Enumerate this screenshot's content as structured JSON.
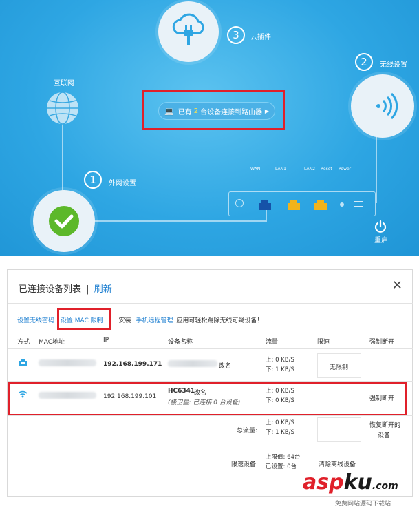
{
  "top": {
    "cloud_num": "3",
    "cloud_label": "云插件",
    "wireless_num": "2",
    "wireless_label": "无线设置",
    "internet_label": "互联网",
    "wan_num": "1",
    "wan_label": "外网设置",
    "devices_prefix": "已有",
    "devices_count": "2",
    "devices_suffix": "台设备连接到路由器",
    "ports": [
      "WAN",
      "LAN1",
      "LAN2",
      "Reset",
      "Power"
    ],
    "restart_label": "重启"
  },
  "panel": {
    "title": "已连接设备列表",
    "title_sep": "|",
    "refresh": "刷新",
    "toolbar": {
      "wifi_password": "设置无线密码",
      "mac_limit": "设置 MAC 限制",
      "install": "安装",
      "app_link": "手机远程管理",
      "app_desc": "应用可轻松踢除无线可疑设备！"
    },
    "headers": [
      "方式",
      "MAC地址",
      "IP",
      "设备名称",
      "流量",
      "限速",
      "强制断开"
    ],
    "rows": [
      {
        "type": "lan",
        "ip": "192.168.199.171",
        "name": "",
        "rename": "改名",
        "up": "上: 0 KB/S",
        "down": "下: 1 KB/S",
        "limit": "无限制",
        "action": ""
      },
      {
        "type": "wifi",
        "ip": "192.168.199.101",
        "name": "HC6341",
        "rename": "改名",
        "sub": "(极卫星: 已连接 0 台设备)",
        "up": "上: 0 KB/S",
        "down": "下: 0 KB/S",
        "limit": "",
        "action": "强制断开"
      }
    ],
    "total": {
      "label": "总流量:",
      "up": "上: 0 KB/S",
      "down": "下: 1 KB/S",
      "restore": "恢复断开的",
      "restore2": "设备"
    },
    "limited": {
      "label": "限速设备:",
      "max": "上限值: 64台",
      "set": "已设置: 0台",
      "clear": "清除离线设备"
    }
  },
  "watermark": {
    "a": "asp",
    "b": "ku",
    "c": ".com",
    "sub": "免费网站源码下载站"
  },
  "colors": {
    "accent": "#1e7fd0",
    "highlight": "#e0202a",
    "bg_top": "#2ea6e3"
  }
}
